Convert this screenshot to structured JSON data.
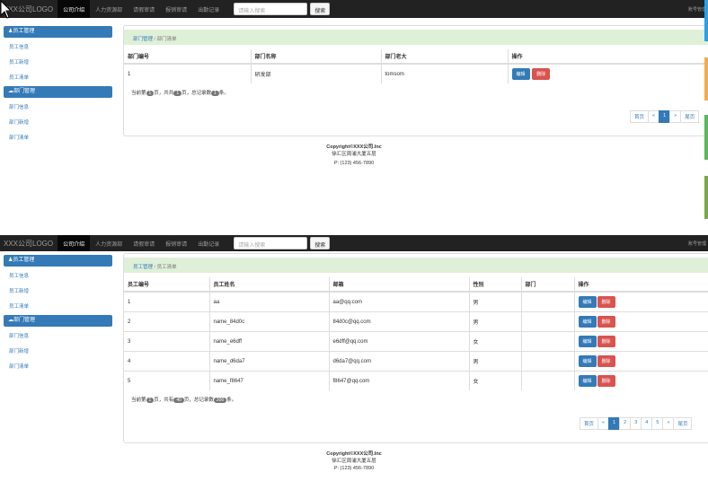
{
  "nav": {
    "brand": "XXX公司LOGO",
    "items": [
      "公司介绍",
      "人力资源部",
      "请假审请",
      "报销审请",
      "出勤记录"
    ],
    "search_placeholder": "请输入搜索",
    "search_button": "搜索",
    "right_link": "账号管理"
  },
  "sidebar": {
    "employee_header": "员工管理",
    "employee_links": [
      "员工信息",
      "员工新增",
      "员工清单"
    ],
    "dept_header": "部门管理",
    "dept_links": [
      "部门信息",
      "部门新增",
      "部门清单"
    ]
  },
  "screen1": {
    "breadcrumb": [
      "部门管理",
      "部门清单"
    ],
    "columns": [
      "部门编号",
      "部门名称",
      "部门老大",
      "操作"
    ],
    "rows": [
      {
        "id": "1",
        "name": "研发部",
        "leader": "tomsom"
      }
    ],
    "edit_label": "编辑",
    "delete_label": "删除",
    "summary": {
      "pre": "当前第",
      "current": "1",
      "mid1": "页，共共",
      "total": "1",
      "mid2": "页，总记录数",
      "records": "1",
      "post": "条。"
    },
    "pager": [
      "首页",
      "«",
      "1",
      "»",
      "尾页"
    ]
  },
  "screen2": {
    "breadcrumb": [
      "员工管理",
      "员工清单"
    ],
    "columns": [
      "员工编号",
      "员工姓名",
      "邮箱",
      "性别",
      "部门",
      "操作"
    ],
    "rows": [
      {
        "id": "1",
        "name": "aa",
        "email": "aa@qq.com",
        "gender": "男",
        "dept": ""
      },
      {
        "id": "2",
        "name": "name_84d0c",
        "email": "84d0c@qq.com",
        "gender": "男",
        "dept": ""
      },
      {
        "id": "3",
        "name": "name_e6dff",
        "email": "e6dff@qq.com",
        "gender": "女",
        "dept": ""
      },
      {
        "id": "4",
        "name": "name_d6da7",
        "email": "d6da7@qq.com",
        "gender": "男",
        "dept": ""
      },
      {
        "id": "5",
        "name": "name_f8647",
        "email": "f8647@qq.com",
        "gender": "女",
        "dept": ""
      }
    ],
    "edit_label": "编辑",
    "delete_label": "删除",
    "summary": {
      "pre": "当前第",
      "current": "1",
      "mid1": "页，共有",
      "total": "40",
      "mid2": "页，总记录数",
      "records": "200",
      "post": "条。"
    },
    "pager": [
      "首页",
      "«",
      "1",
      "2",
      "3",
      "4",
      "5",
      "»",
      "尾页"
    ]
  },
  "footer": {
    "copyright": "Copyright©XXX公司.Inc",
    "address": "徐汇区周浦大厦五层",
    "phone": "P: (123) 456-7890"
  },
  "colors": {
    "navbar": "#222222",
    "primary": "#337ab7",
    "danger": "#d9534f",
    "breadcrumb_bg": "#dff0d8",
    "edge_strips": [
      "#2aa0e6",
      "#f0ad4e",
      "#5cb85c",
      "#7aa84c"
    ]
  }
}
